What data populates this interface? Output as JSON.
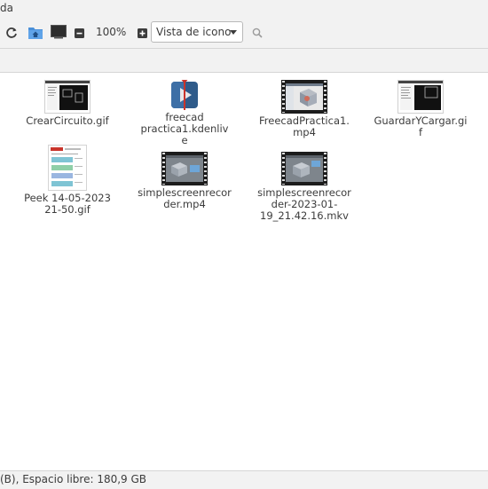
{
  "window": {
    "title_fragment": "da"
  },
  "toolbar": {
    "zoom_level": "100%",
    "view_mode": "Vista de icono",
    "icons": [
      "reload-icon",
      "home-folder-icon",
      "terminal-icon",
      "zoom-out-icon",
      "zoom-in-icon",
      "search-icon"
    ]
  },
  "files": [
    {
      "name": "CrearCircuito.gif",
      "kind": "gif-dark"
    },
    {
      "name": "freecad practica1.kdenlive",
      "kind": "kdenlive"
    },
    {
      "name": "FreecadPractica1.mp4",
      "kind": "video"
    },
    {
      "name": "GuardarYCargar.gif",
      "kind": "gif-dark"
    },
    {
      "name": "Peek 14-05-2023 21-50.gif",
      "kind": "gif-light"
    },
    {
      "name": "simplescreenrecorder.mp4",
      "kind": "video"
    },
    {
      "name": "simplescreenrecorder-2023-01-19_21.42.16.mkv",
      "kind": "video"
    }
  ],
  "status": {
    "text": "(B), Espacio libre: 180,9 GB"
  },
  "colors": {
    "toolbar_bg": "#f2f2f2",
    "folder_blue": "#4a90d9",
    "kdenlive_blue": "#2f5b8a"
  }
}
